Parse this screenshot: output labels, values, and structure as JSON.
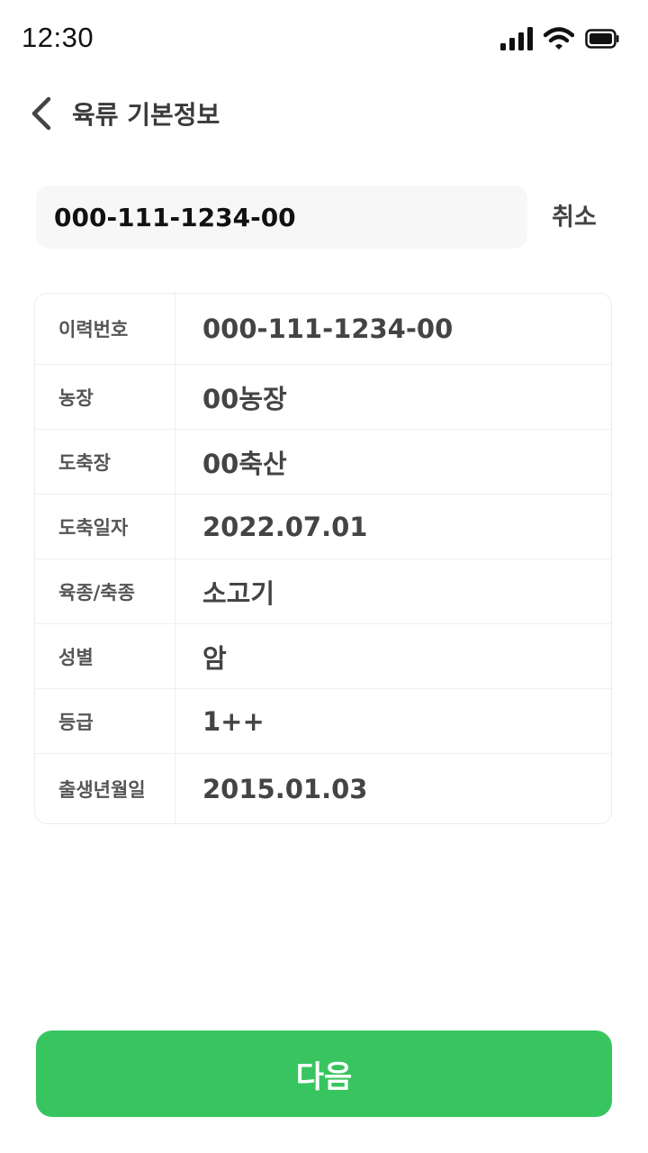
{
  "status_bar": {
    "time": "12:30",
    "icons": [
      "cellular-signal-icon",
      "wifi-icon",
      "battery-icon"
    ]
  },
  "header": {
    "back_icon": "chevron-left-icon",
    "title": "육류 기본정보"
  },
  "search": {
    "value": "000-111-1234-00",
    "cancel_label": "취소"
  },
  "info": {
    "rows": [
      {
        "label": "이력번호",
        "value": "000-111-1234-00"
      },
      {
        "label": "농장",
        "value": "00농장"
      },
      {
        "label": "도축장",
        "value": "00축산"
      },
      {
        "label": "도축일자",
        "value": "2022.07.01"
      },
      {
        "label": "육종/축종",
        "value": "소고기"
      },
      {
        "label": "성별",
        "value": "암"
      },
      {
        "label": "등급",
        "value": "1++"
      },
      {
        "label": "출생년월일",
        "value": "2015.01.03"
      }
    ]
  },
  "footer": {
    "next_label": "다음"
  },
  "colors": {
    "primary": "#38c560",
    "search_bg": "#f7f7f7",
    "border": "#ececec"
  }
}
